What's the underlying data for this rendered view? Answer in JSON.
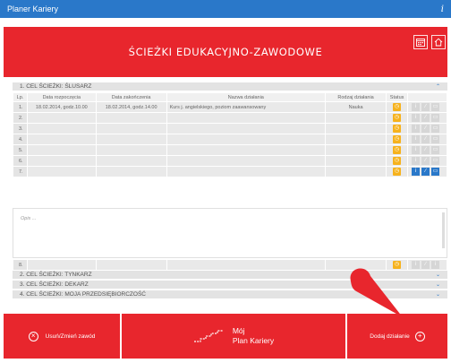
{
  "window": {
    "title": "Planer Kariery",
    "info_glyph": "i"
  },
  "banner": {
    "title": "ŚCIEŻKI EDUKACYJNO-ZAWODOWE",
    "icons": [
      "calendar-icon",
      "home-icon"
    ]
  },
  "sections": [
    {
      "num": "1.",
      "label": "CEL ŚCIEŻKI: ŚLUSARZ"
    },
    {
      "num": "2.",
      "label": "CEL ŚCIEŻKI: TYNKARZ"
    },
    {
      "num": "3.",
      "label": "CEL ŚCIEŻKI: DEKARZ"
    },
    {
      "num": "4.",
      "label": "CEL ŚCIEŻKI: MOJA PRZEDSIĘBIORCZOŚĆ"
    }
  ],
  "table": {
    "headers": [
      "Lp.",
      "Data rozpoczęcia",
      "Data zakończenia",
      "Nazwa działania",
      "Rodzaj działania",
      "Status"
    ],
    "rows": [
      {
        "lp": "1.",
        "start": "18.02.2014, godz.10.00",
        "end": "18.02.2014, godz.14.00",
        "name": "Kurs j. angielskiego, poziom zaawansowany",
        "type": "Nauka"
      },
      {
        "lp": "2.",
        "start": "",
        "end": "",
        "name": "",
        "type": ""
      },
      {
        "lp": "3.",
        "start": "",
        "end": "",
        "name": "",
        "type": ""
      },
      {
        "lp": "4.",
        "start": "",
        "end": "",
        "name": "",
        "type": ""
      },
      {
        "lp": "5.",
        "start": "",
        "end": "",
        "name": "",
        "type": ""
      },
      {
        "lp": "6.",
        "start": "",
        "end": "",
        "name": "",
        "type": ""
      },
      {
        "lp": "7.",
        "start": "",
        "end": "",
        "name": "",
        "type": ""
      }
    ],
    "row8": {
      "lp": "8."
    }
  },
  "description": {
    "placeholder": "Opis ..."
  },
  "footer": {
    "left_label": "Usuń/Zmień zawód",
    "center_line1": "Mój",
    "center_line2": "Plan Kariery",
    "right_label": "Dodaj działanie"
  }
}
